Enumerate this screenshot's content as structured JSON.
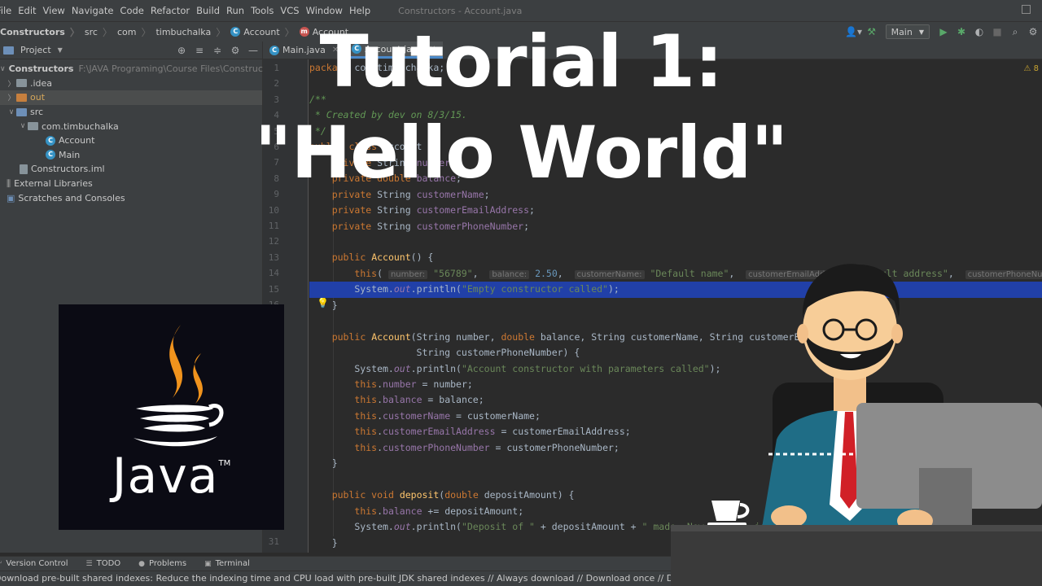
{
  "menu": {
    "items": [
      "File",
      "Edit",
      "View",
      "Navigate",
      "Code",
      "Refactor",
      "Build",
      "Run",
      "Tools",
      "VCS",
      "Window",
      "Help"
    ],
    "window_title": "Constructors - Account.java"
  },
  "breadcrumb": {
    "items": [
      "Constructors",
      "src",
      "com",
      "timbuchalka",
      "Account",
      "Account"
    ]
  },
  "run_config": "Main",
  "project": {
    "header": "Project",
    "root_name": "Constructors",
    "root_path": "F:\\JAVA Programing\\Course Files\\Constructors",
    "tree": [
      ".idea",
      "out",
      "src",
      "com.timbuchalka",
      "Account",
      "Main",
      "Constructors.iml",
      "External Libraries",
      "Scratches and Consoles"
    ]
  },
  "tabs": [
    "Main.java",
    "Account.java"
  ],
  "editor": {
    "line_numbers": [
      "1",
      "2",
      "3",
      "4",
      "5",
      "6",
      "7",
      "8",
      "9",
      "10",
      "11",
      "12",
      "13",
      "14",
      "15",
      "16",
      "31"
    ],
    "warning_count": "8",
    "hints": {
      "number": "number:",
      "balance": "balance:",
      "customerName": "customerName:",
      "customerEmailAddress": "customerEmailAddress:",
      "customerPhoneNumber": "customerPhoneNumber:"
    }
  },
  "tool_windows": [
    "Version Control",
    "TODO",
    "Problems",
    "Terminal"
  ],
  "status_message": "Download pre-built shared indexes: Reduce the indexing time and CPU load with pre-built JDK shared indexes // Always download // Download once // Don't show again // Configure...",
  "overlay": {
    "line1": "Tutorial 1:",
    "line2": "\"Hello World\""
  },
  "java_logo": {
    "word": "Java",
    "tm": "TM"
  },
  "colors": {
    "accent": "#4a88c7",
    "highlight_line": "#2140a8",
    "java_orange": "#f0931d",
    "run_green": "#59a869"
  }
}
